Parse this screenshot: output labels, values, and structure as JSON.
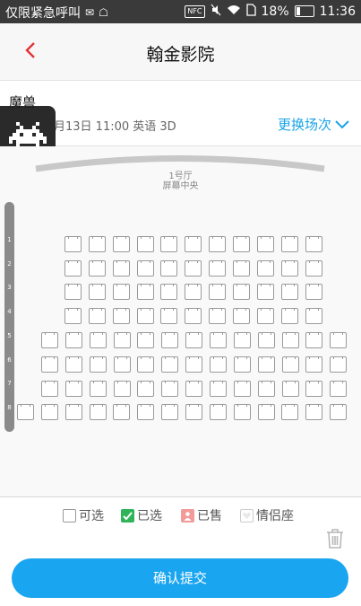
{
  "status_bar": {
    "carrier": "仅限紧急呼叫",
    "nfc": "NFC",
    "battery": "18%",
    "time": "11:36"
  },
  "header": {
    "title": "翰金影院"
  },
  "movie": {
    "name": "魔兽",
    "showtime": "月13日 11:00 英语 3D",
    "change_label": "更换场次"
  },
  "hall": {
    "name": "1号厅",
    "screen_label": "屏幕中央"
  },
  "rows": [
    "1",
    "2",
    "3",
    "4",
    "5",
    "6",
    "7",
    "8"
  ],
  "legend": {
    "available": "可选",
    "selected": "已选",
    "sold": "已售",
    "couple": "情侣座"
  },
  "submit_label": "确认提交",
  "colors": {
    "accent": "#1aa5f0",
    "back_arrow": "#e0353a",
    "selected": "#2fb45a",
    "sold": "#f39a9a"
  }
}
